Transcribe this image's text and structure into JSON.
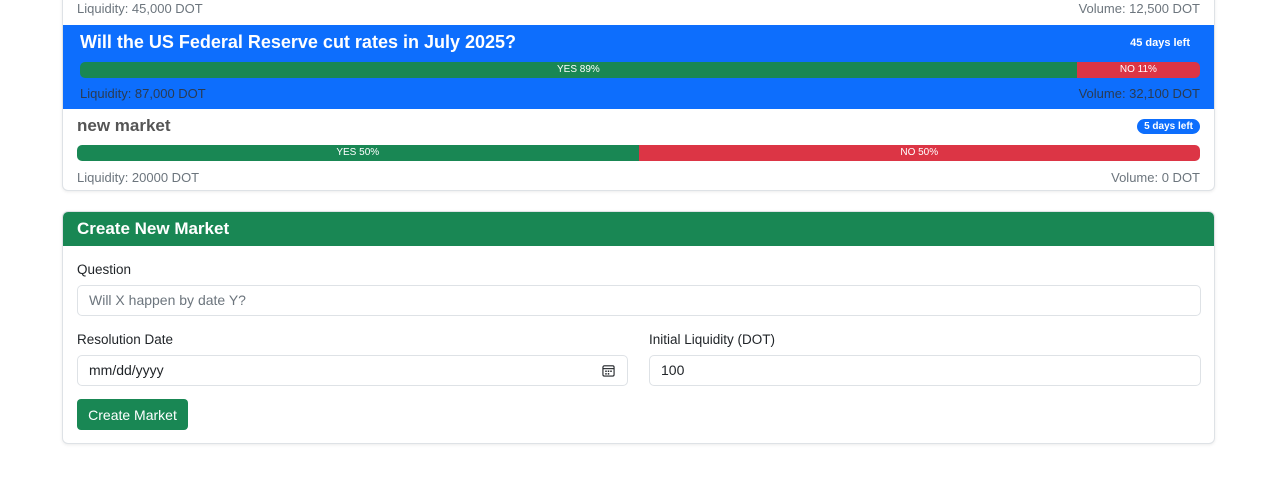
{
  "markets": {
    "previous": {
      "liquidity": "Liquidity: 45,000 DOT",
      "volume": "Volume: 12,500 DOT"
    },
    "selected": {
      "question": "Will the US Federal Reserve cut rates in July 2025?",
      "days_left": "45 days left",
      "yes_label": "YES 89%",
      "no_label": "NO 11%",
      "yes_fraction": 0.89,
      "no_fraction": 0.11,
      "liquidity": "Liquidity: 87,000 DOT",
      "volume": "Volume: 32,100 DOT"
    },
    "new_market": {
      "question": "new market",
      "days_left": "5 days left",
      "yes_label": "YES 50%",
      "no_label": "NO 50%",
      "yes_fraction": 0.5,
      "no_fraction": 0.5,
      "liquidity": "Liquidity: 20000 DOT",
      "volume": "Volume: 0 DOT"
    }
  },
  "create_form": {
    "title": "Create New Market",
    "question_label": "Question",
    "question_placeholder": "Will X happen by date Y?",
    "date_label": "Resolution Date",
    "date_placeholder": "mm/dd/yyyy",
    "liquidity_label": "Initial Liquidity (DOT)",
    "liquidity_value": "100",
    "submit_label": "Create Market"
  },
  "colors": {
    "primary": "#0d6efd",
    "success": "#198754",
    "danger": "#dc3545"
  }
}
